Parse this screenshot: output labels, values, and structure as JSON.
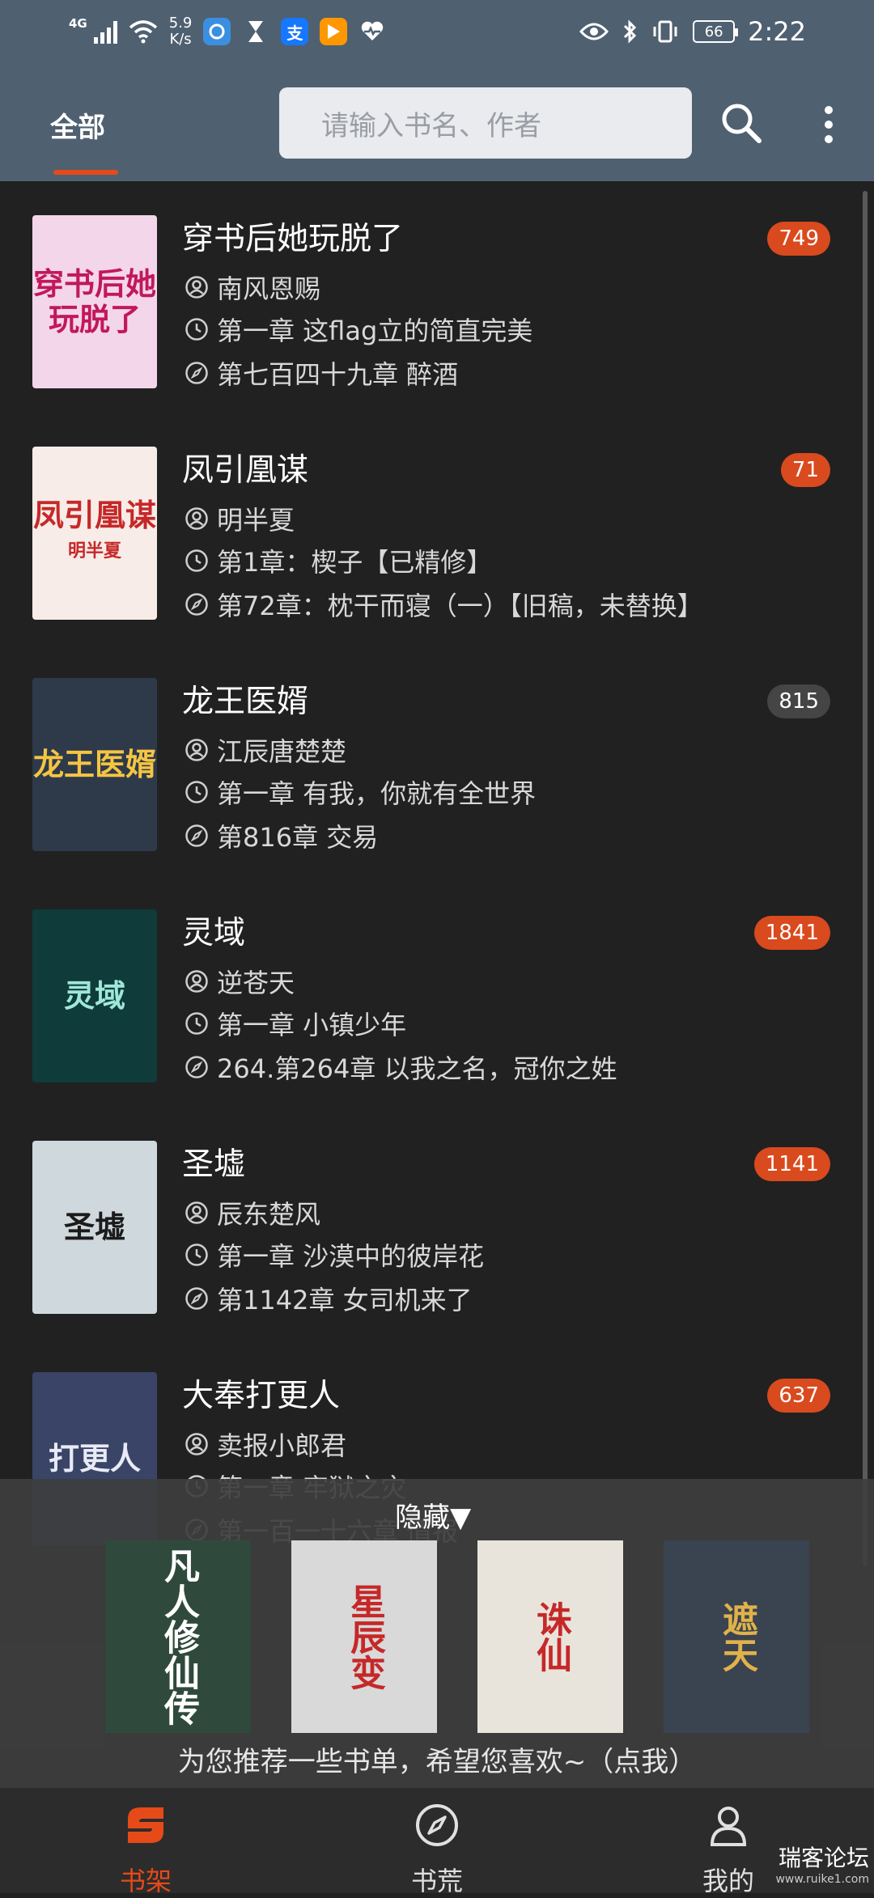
{
  "status_bar": {
    "network_type": "4G",
    "speed_value": "5.9",
    "speed_unit": "K/s",
    "battery": "66",
    "time": "2:22",
    "app_icons": [
      "browser-icon",
      "hourglass-icon",
      "alipay-icon",
      "video-icon",
      "health-icon"
    ]
  },
  "header": {
    "tab_label": "全部",
    "search_placeholder": "请输入书名、作者"
  },
  "books": [
    {
      "title": "穿书后她玩脱了",
      "author": "南风恩赐",
      "first_chapter": "第一章 这flag立的简直完美",
      "latest_chapter": "第七百四十九章 醉酒",
      "badge": "749",
      "badge_color": "#d94a1e",
      "cover_text": "穿书后她玩脱了",
      "cover_bg": "#f3d6ea",
      "cover_fg": "#c2185b"
    },
    {
      "title": "凤引凰谋",
      "author": "明半夏",
      "first_chapter": "第1章：楔子【已精修】",
      "latest_chapter": "第72章：枕干而寝（一）【旧稿，未替换】",
      "badge": "71",
      "badge_color": "#d94a1e",
      "cover_text": "凤引凰谋",
      "cover_sub": "明半夏",
      "cover_bg": "#f7ece8",
      "cover_fg": "#c62828"
    },
    {
      "title": "龙王医婿",
      "author": "江辰唐楚楚",
      "first_chapter": "第一章 有我，你就有全世界",
      "latest_chapter": "第816章 交易",
      "badge": "815",
      "badge_color": "#454545",
      "cover_text": "龙王医婿",
      "cover_bg": "#2e3a4a",
      "cover_fg": "#f5c542"
    },
    {
      "title": "灵域",
      "author": "逆苍天",
      "first_chapter": "第一章 小镇少年",
      "latest_chapter": "264.第264章 以我之名，冠你之姓",
      "badge": "1841",
      "badge_color": "#d94a1e",
      "cover_text": "灵域",
      "cover_bg": "#0f3b3a",
      "cover_fg": "#9fe8d9"
    },
    {
      "title": "圣墟",
      "author": "辰东楚风",
      "first_chapter": "第一章 沙漠中的彼岸花",
      "latest_chapter": "第1142章 女司机来了",
      "badge": "1141",
      "badge_color": "#d94a1e",
      "cover_text": "圣墟",
      "cover_bg": "#cfd8dc",
      "cover_fg": "#1b1b1b"
    },
    {
      "title": "大奉打更人",
      "author": "卖报小郎君",
      "first_chapter": "第一章 牢狱之灾",
      "latest_chapter": "第一百一十六章 情报",
      "badge": "637",
      "badge_color": "#d94a1e",
      "cover_text": "打更人",
      "cover_bg": "#3a4466",
      "cover_fg": "#e8eaf6"
    }
  ],
  "recommendation": {
    "toggle_label": "隐藏▼",
    "caption": "为您推荐一些书单，希望您喜欢~（点我）",
    "covers": [
      {
        "text": "凡人修仙传",
        "bg": "#2f4a3c",
        "fg": "#ffffff"
      },
      {
        "text": "星辰变",
        "bg": "#d9d9d9",
        "fg": "#c62828"
      },
      {
        "text": "诛仙",
        "bg": "#e8e4dc",
        "fg": "#c62828"
      },
      {
        "text": "遮天",
        "bg": "#3a4350",
        "fg": "#e0b24a"
      }
    ]
  },
  "bottom_nav": {
    "items": [
      {
        "label": "书架",
        "icon": "bookshelf-icon",
        "active": true
      },
      {
        "label": "书荒",
        "icon": "compass-icon",
        "active": false
      },
      {
        "label": "我的",
        "icon": "user-icon",
        "active": false
      }
    ],
    "active_color": "#e64a19",
    "inactive_color": "#e0e0e0"
  },
  "watermark": {
    "text": "瑞客论坛",
    "sub": "www.ruike1.com"
  }
}
